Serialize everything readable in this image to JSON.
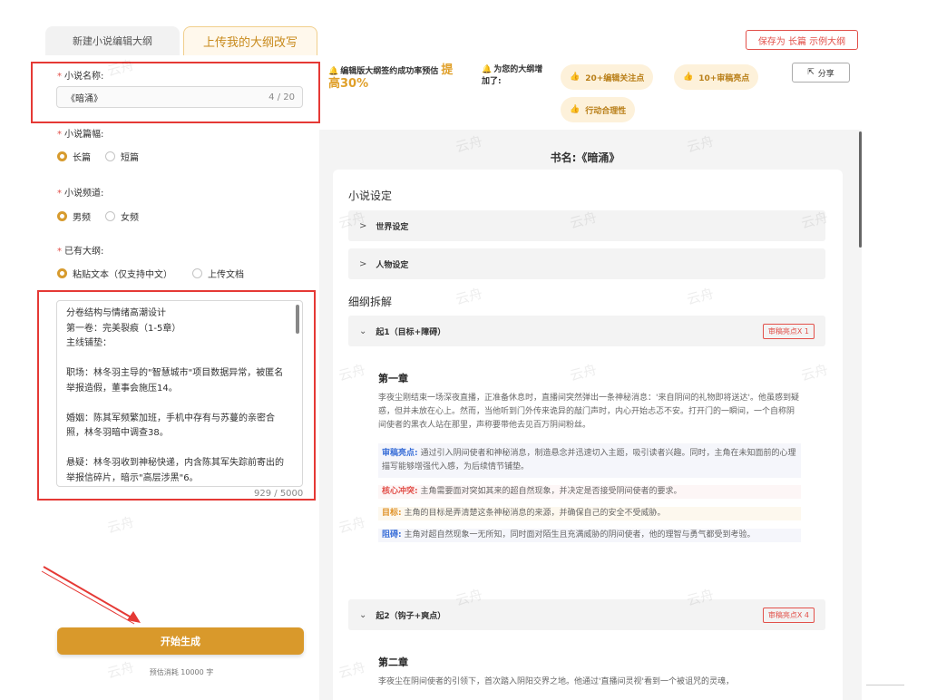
{
  "tabs": {
    "new_outline": "新建小说编辑大纲",
    "upload_outline": "上传我的大纲改写"
  },
  "header": {
    "save_label": "保存为 长篇 示例大纲"
  },
  "form": {
    "novel_name_label": "小说名称:",
    "novel_name_value": "《暗涌》",
    "novel_name_count": "4 / 20",
    "length_label": "小说篇幅:",
    "length_options": [
      "长篇",
      "短篇"
    ],
    "length_selected": "长篇",
    "channel_label": "小说频道:",
    "channel_options": [
      "男频",
      "女频"
    ],
    "channel_selected": "男频",
    "outline_label": "已有大纲:",
    "outline_options": [
      "粘贴文本（仅支持中文）",
      "上传文档"
    ],
    "outline_selected": "粘贴文本（仅支持中文）",
    "outline_text": "分卷结构与情绪高潮设计\n第一卷：完美裂痕（1-5章）\n主线铺垫：\n\n职场：林冬羽主导的\"智慧城市\"项目数据异常，被匿名举报造假，董事会施压14。\n\n婚姻：陈其军频繁加班，手机中存有与苏蔓的亲密合照，林冬羽暗中调查38。\n\n悬疑：林冬羽收到神秘快递，内含陈其军失踪前寄出的举报信碎片，暗示\"高层涉黑\"6。",
    "outline_count": "929 / 5000",
    "generate_label": "开始生成",
    "cost_text": "预估消耗 10000 字"
  },
  "tips": {
    "tip1_text": "编辑版大纲签约成功率预估",
    "tip1_highlight_a": "提",
    "tip1_highlight_b": "高30%",
    "tip2_text_a": "为您的大纲增",
    "tip2_text_b": "加了:",
    "chips": [
      "20+编辑关注点",
      "10+审稿亮点",
      "行动合理性"
    ],
    "share_label": "分享"
  },
  "doc": {
    "book_title": "书名:《暗涌》",
    "settings_title": "小说设定",
    "world_setting": "世界设定",
    "character_setting": "人物设定",
    "breakdown_title": "细纲拆解",
    "sections": [
      {
        "title": "起1（目标+障碍）",
        "badge": "审稿亮点X 1",
        "chapter": "第一章",
        "summary": "李夜尘刚结束一场深夜直播，正准备休息时，直播间突然弹出一条神秘消息：'来自阴间的礼物即将送达'。他虽感到疑惑，但并未放在心上。然而，当他听到门外传来诡异的敲门声时，内心开始忐忑不安。打开门的一瞬间，一个自称阴间使者的黑衣人站在那里，声称要带他去见百万阴间粉丝。",
        "notes": [
          {
            "label": "审稿亮点:",
            "text": "通过引入阴间使者和神秘消息，制造悬念并迅速切入主题，吸引读者兴趣。同时，主角在未知面前的心理描写能够增强代入感，为后续情节铺垫。"
          },
          {
            "label": "核心冲突:",
            "text": "主角需要面对突如其来的超自然现象，并决定是否接受阴间使者的要求。"
          },
          {
            "label": "目标:",
            "text": "主角的目标是弄清楚这条神秘消息的来源，并确保自己的安全不受威胁。"
          },
          {
            "label": "阻碍:",
            "text": "主角对超自然现象一无所知，同时面对陌生且充满威胁的阴间使者，他的理智与勇气都受到考验。"
          }
        ]
      },
      {
        "title": "起2（钩子+爽点）",
        "badge": "审稿亮点X 4",
        "chapter": "第二章",
        "summary": "李夜尘在阴间使者的引领下，首次踏入阴阳交界之地。他通过'直播间灵视'看到一个被诅咒的灵魂，"
      }
    ]
  },
  "watermark": "云舟",
  "colors": {
    "accent": "#d9992b",
    "danger": "#e2504a",
    "link_blue": "#3a6fd8"
  }
}
